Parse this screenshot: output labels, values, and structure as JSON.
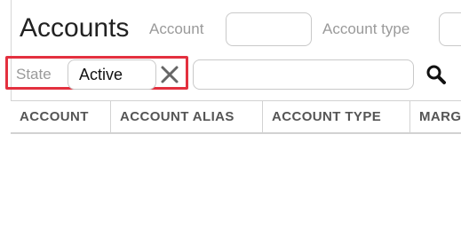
{
  "header": {
    "title": "Accounts",
    "filters": {
      "account_label": "Account",
      "account_value": "",
      "account_type_label": "Account type",
      "account_type_value": ""
    }
  },
  "filter_row": {
    "state_label": "State",
    "state_value": "Active",
    "clear_icon": "close-icon",
    "search_value": "",
    "search_icon": "search-icon"
  },
  "table": {
    "columns": [
      "ACCOUNT",
      "ACCOUNT ALIAS",
      "ACCOUNT TYPE",
      "MARG"
    ],
    "rows": []
  },
  "colors": {
    "highlight": "#e3303f"
  }
}
